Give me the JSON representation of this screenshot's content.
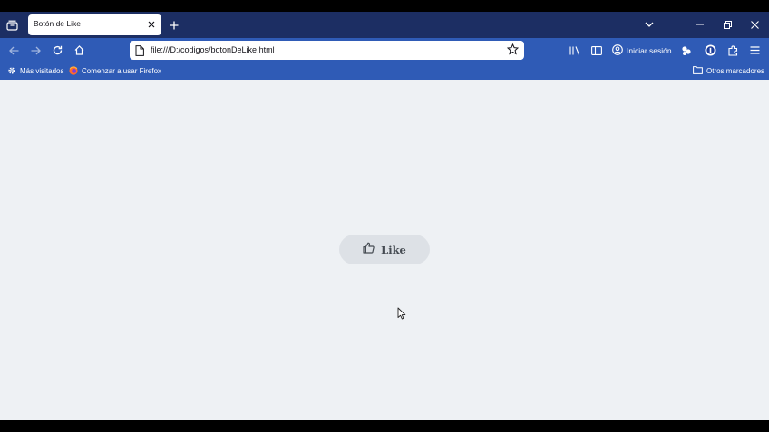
{
  "browser": {
    "tab": {
      "title": "Botón de Like"
    },
    "url": "file:///D:/codigos/botonDeLike.html",
    "signin_label": "Iniciar sesión",
    "bookmarks": [
      {
        "label": "Más visitados",
        "icon": "gear-icon"
      },
      {
        "label": "Comenzar a usar Firefox",
        "icon": "firefox-icon"
      }
    ],
    "other_bookmarks_label": "Otros marcadores"
  },
  "page": {
    "like_button": {
      "label": "Like",
      "icon": "thumbs-up-icon"
    },
    "background_color": "#eef1f4",
    "button_color": "#dde1e6"
  },
  "colors": {
    "tabbar": "#1c2e63",
    "toolbar": "#2f5bb6"
  }
}
